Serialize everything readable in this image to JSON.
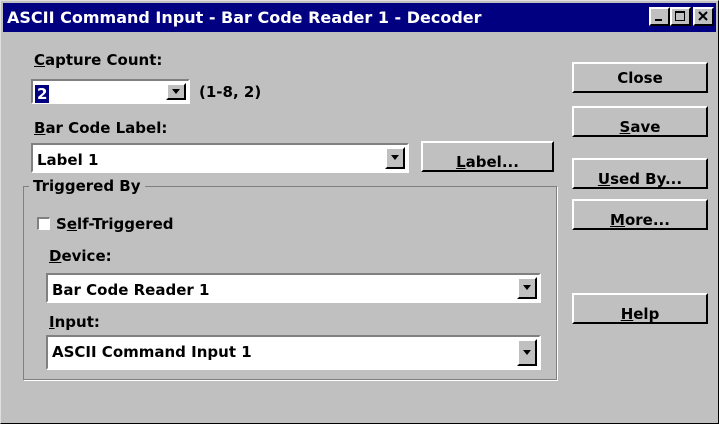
{
  "window": {
    "title": "ASCII Command Input - Bar Code Reader 1 - Decoder"
  },
  "capture_count": {
    "label_accel": "C",
    "label_rest": "apture Count:",
    "value": "2",
    "range_hint": "(1-8, 2)"
  },
  "bar_code_label": {
    "label_accel": "B",
    "label_rest": "ar Code Label:",
    "value": "Label 1",
    "button_accel": "L",
    "button_rest": "abel..."
  },
  "triggered_by": {
    "legend": "Triggered By",
    "self_triggered": {
      "pre": "S",
      "accel": "e",
      "rest": "lf-Triggered",
      "checked": false
    },
    "device": {
      "label_accel": "D",
      "label_rest": "evice:",
      "value": "Bar Code Reader 1"
    },
    "input": {
      "label_accel": "I",
      "label_rest": "nput:",
      "value": "ASCII Command Input 1"
    }
  },
  "buttons": {
    "close": "Close",
    "save_accel": "S",
    "save_rest": "ave",
    "usedby_accel": "U",
    "usedby_rest": "sed By...",
    "more_accel": "M",
    "more_rest": "ore...",
    "help_accel": "H",
    "help_rest": "elp"
  },
  "icons": {
    "minimize": "minimize-icon",
    "maximize": "maximize-icon",
    "close": "close-icon",
    "dropdown": "chevron-down-icon"
  },
  "colors": {
    "titlebar": "#000080",
    "face": "#c0c0c0",
    "selection": "#000080"
  }
}
